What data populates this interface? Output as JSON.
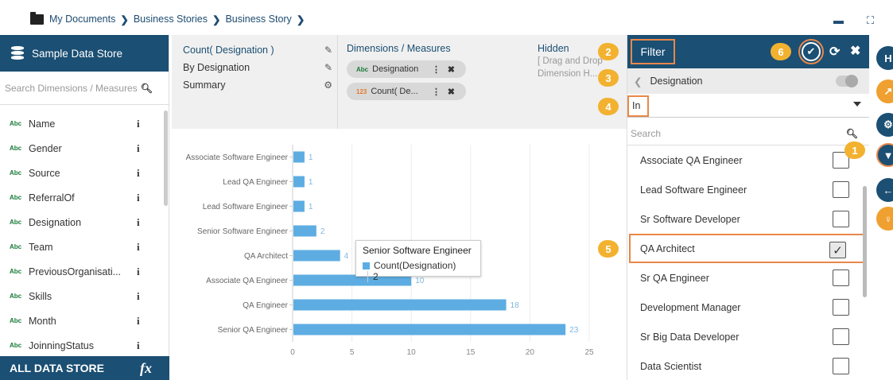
{
  "breadcrumb": {
    "items": [
      "My Documents",
      "Business Stories",
      "Business Story"
    ],
    "sep": "❯"
  },
  "toolbar": {
    "comment_icon": "▬",
    "expand_icon": "⛶"
  },
  "left_panel": {
    "title": "Sample Data Store",
    "search_placeholder": "Search Dimensions / Measures",
    "type_badge": "Abc",
    "info_glyph": "i",
    "items": [
      "Name",
      "Gender",
      "Source",
      "ReferralOf",
      "Designation",
      "Team",
      "PreviousOrganisati...",
      "Skills",
      "Month",
      "JoinningStatus"
    ],
    "footer": "ALL DATA STORE",
    "footer_icon": "fx"
  },
  "config": {
    "col1": [
      "Count( Designation )",
      "By Designation",
      "Summary"
    ],
    "dimensions_header": "Dimensions / Measures",
    "chips": [
      {
        "badge": "Abc",
        "label": "Designation"
      },
      {
        "badge": "123",
        "label": "Count( De..."
      }
    ],
    "hidden_header": "Hidden",
    "hidden_hint_1": "[ Drag and Drop",
    "hidden_hint_2": "Dimension H..."
  },
  "chart_data": {
    "type": "bar",
    "orientation": "horizontal",
    "categories": [
      "Associate Software Engineer",
      "Lead QA Engineer",
      "Lead Software Engineer",
      "Senior Software Engineer",
      "QA Architect",
      "Associate QA Engineer",
      "QA Engineer",
      "Senior QA Engineer"
    ],
    "series": [
      {
        "name": "Count(Designation)",
        "values": [
          1,
          1,
          1,
          2,
          4,
          10,
          18,
          23
        ]
      }
    ],
    "xlim": [
      0,
      25
    ],
    "xticks": [
      0,
      5,
      10,
      15,
      20,
      25
    ],
    "bar_color": "#5dade2",
    "grid": true
  },
  "tooltip": {
    "title": "Senior Software Engineer",
    "series": "Count(Designation)",
    "value": "2"
  },
  "filter": {
    "title": "Filter",
    "field": "Designation",
    "operator": "In",
    "search_placeholder": "Search",
    "options": [
      {
        "label": "Associate QA Engineer",
        "checked": false
      },
      {
        "label": "Lead Software Engineer",
        "checked": false
      },
      {
        "label": "Sr Software Developer",
        "checked": false
      },
      {
        "label": "QA Architect",
        "checked": true
      },
      {
        "label": "Sr QA Engineer",
        "checked": false
      },
      {
        "label": "Development Manager",
        "checked": false
      },
      {
        "label": "Sr Big Data Developer",
        "checked": false
      },
      {
        "label": "Data Scientist",
        "checked": false
      }
    ]
  },
  "callouts": [
    "1",
    "2",
    "3",
    "4",
    "5",
    "6"
  ],
  "colors": {
    "brand": "#1b4f73",
    "highlight": "#e8884a",
    "callout": "#f2b230"
  }
}
